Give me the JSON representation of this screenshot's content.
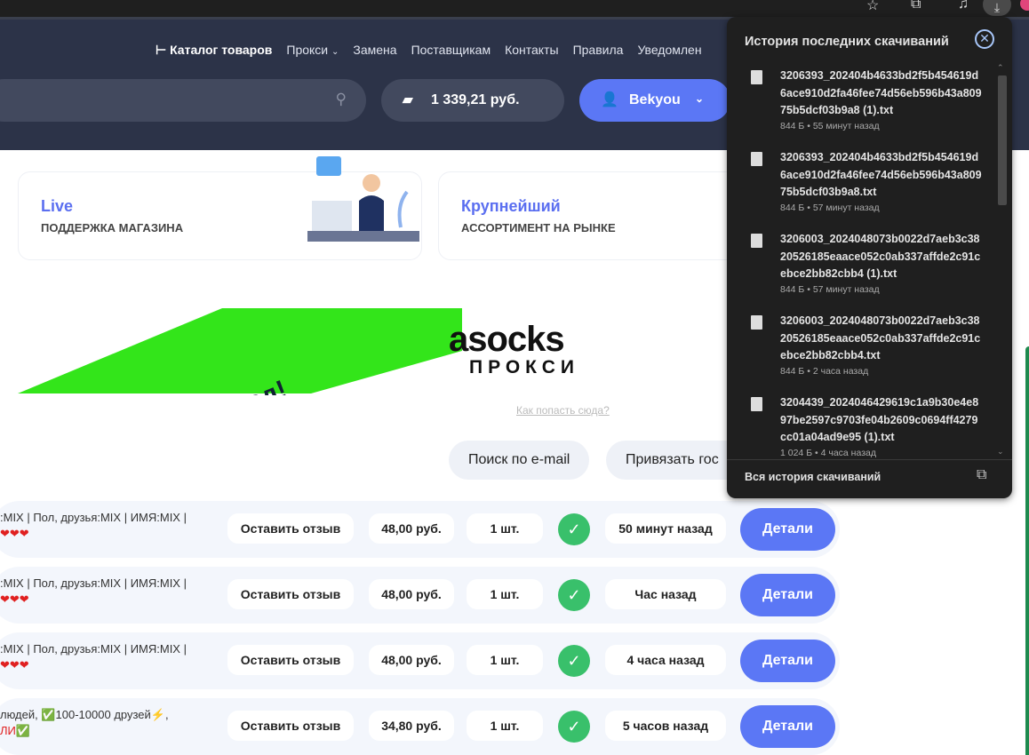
{
  "browser": {
    "star_icon": "star-icon",
    "download_icon": "download-icon"
  },
  "header": {
    "nav": {
      "catalog": "Каталог товаров",
      "proxy": "Прокси",
      "replace": "Замена",
      "suppliers": "Поставщикам",
      "contacts": "Контакты",
      "rules": "Правила",
      "notifications": "Уведомлен"
    },
    "balance": "1 339,21 руб.",
    "add": "+",
    "user": "Bekyou"
  },
  "features": [
    {
      "title": "Live",
      "subtitle": "ПОДДЕРЖКА МАГАЗИНА"
    },
    {
      "title": "Крупнейший",
      "subtitle": "АССОРТИМЕНТ НА РЫНКЕ"
    }
  ],
  "ad": {
    "banner_text": "на завод!",
    "logo": "asocks",
    "logo_sub": "ПРОКСИ",
    "howto": "Как попасть сюда?"
  },
  "actions": {
    "search_email": "Поиск по e-mail",
    "bind": "Привязать гос"
  },
  "orders": [
    {
      "desc1": ":MIX | Пол, друзья:MIX | ИМЯ:MIX |",
      "desc2": "❤❤❤",
      "review": "Оставить отзыв",
      "price": "48,00 руб.",
      "qty": "1 шт.",
      "time": "50 минут назад",
      "details": "Детали"
    },
    {
      "desc1": ":MIX | Пол, друзья:MIX | ИМЯ:MIX |",
      "desc2": "❤❤❤",
      "review": "Оставить отзыв",
      "price": "48,00 руб.",
      "qty": "1 шт.",
      "time": "Час назад",
      "details": "Детали"
    },
    {
      "desc1": ":MIX | Пол, друзья:MIX | ИМЯ:MIX |",
      "desc2": "❤❤❤",
      "review": "Оставить отзыв",
      "price": "48,00 руб.",
      "qty": "1 шт.",
      "time": "4 часа назад",
      "details": "Детали"
    },
    {
      "desc1": "людей, ✅100-10000 друзей⚡,",
      "desc2": "ЛИ✅",
      "review": "Оставить отзыв",
      "price": "34,80 руб.",
      "qty": "1 шт.",
      "time": "5 часов назад",
      "details": "Детали"
    }
  ],
  "downloads": {
    "title": "История последних скачиваний",
    "items": [
      {
        "name": "3206393_202404b4633bd2f5b454619d6ace910d2fa46fee74d56eb596b43a80975b5dcf03b9a8 (1).txt",
        "meta": "844 Б • 55 минут назад"
      },
      {
        "name": "3206393_202404b4633bd2f5b454619d6ace910d2fa46fee74d56eb596b43a80975b5dcf03b9a8.txt",
        "meta": "844 Б • 57 минут назад"
      },
      {
        "name": "3206003_2024048073b0022d7aeb3c3820526185eaace052c0ab337affde2c91cebce2bb82cbb4 (1).txt",
        "meta": "844 Б • 57 минут назад"
      },
      {
        "name": "3206003_2024048073b0022d7aeb3c3820526185eaace052c0ab337affde2c91cebce2bb82cbb4.txt",
        "meta": "844 Б • 2 часа назад"
      },
      {
        "name": "3204439_2024046429619c1a9b30e4e897be2597c9703fe04b2609c0694ff4279cc01a04ad9e95 (1).txt",
        "meta": "1 024 Б • 4 часа назад"
      }
    ],
    "footer": "Вся история скачиваний"
  }
}
